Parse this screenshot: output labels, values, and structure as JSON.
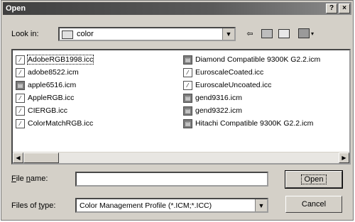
{
  "window": {
    "title": "Open"
  },
  "title_buttons": {
    "help": "?",
    "close": "×"
  },
  "look_in": {
    "label": "Look in:",
    "value": "color"
  },
  "files": {
    "left": [
      {
        "name": "AdobeRGB1998.icc",
        "icon": "page-icon",
        "selected": true
      },
      {
        "name": "adobe8522.icm",
        "icon": "page-icon"
      },
      {
        "name": "apple6516.icm",
        "icon": "profile-icon"
      },
      {
        "name": "AppleRGB.icc",
        "icon": "page-icon"
      },
      {
        "name": "CIERGB.icc",
        "icon": "page-icon"
      },
      {
        "name": "ColorMatchRGB.icc",
        "icon": "page-icon"
      }
    ],
    "right": [
      {
        "name": "Diamond Compatible 9300K G2.2.icm",
        "icon": "profile-icon"
      },
      {
        "name": "EuroscaleCoated.icc",
        "icon": "page-icon"
      },
      {
        "name": "EuroscaleUncoated.icc",
        "icon": "page-icon"
      },
      {
        "name": "gend9316.icm",
        "icon": "profile-icon"
      },
      {
        "name": "gend9322.icm",
        "icon": "profile-icon"
      },
      {
        "name": "Hitachi Compatible 9300K G2.2.icm",
        "icon": "profile-icon"
      }
    ]
  },
  "filename": {
    "label": "File name:",
    "value": ""
  },
  "filetype": {
    "label": "Files of type:",
    "value": "Color Management Profile (*.ICM;*.ICC)"
  },
  "buttons": {
    "open": "Open",
    "cancel": "Cancel"
  }
}
